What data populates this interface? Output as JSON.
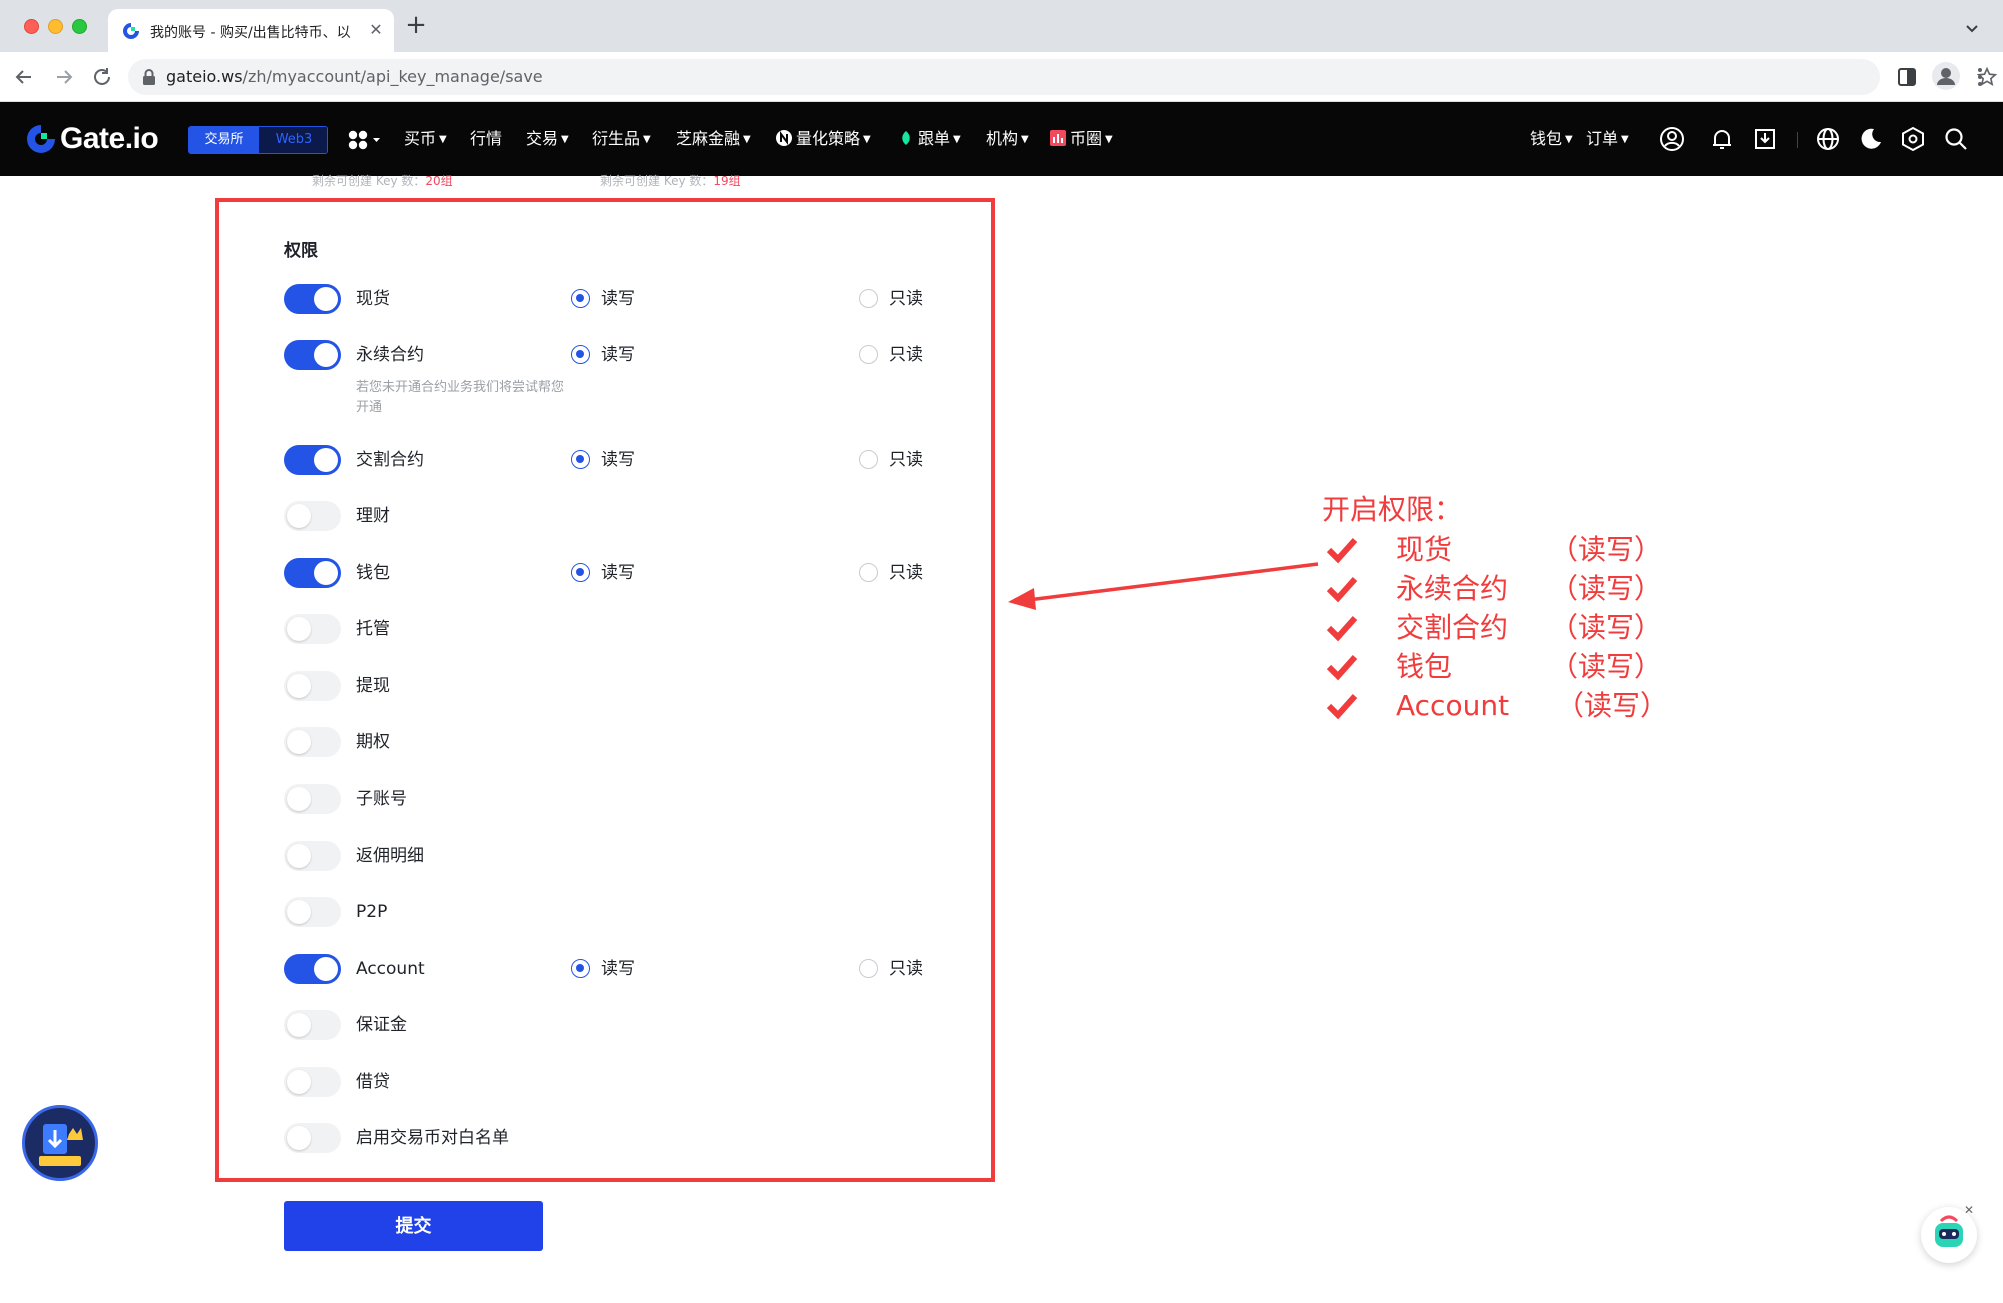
{
  "browser": {
    "tab_title": "我的账号 - 购买/出售比特币、以",
    "url_host": "gateio.ws",
    "url_path": "/zh/myaccount/api_key_manage/save"
  },
  "header": {
    "logo_text": "Gate.io",
    "mode_exchange": "交易所",
    "mode_web3": "Web3",
    "nav": [
      {
        "label": "买币"
      },
      {
        "label": "行情"
      },
      {
        "label": "交易"
      },
      {
        "label": "衍生品"
      },
      {
        "label": "芝麻金融"
      },
      {
        "label": "量化策略"
      },
      {
        "label": "跟单"
      },
      {
        "label": "机构"
      },
      {
        "label": "币圈"
      }
    ],
    "right_nav": [
      {
        "label": "钱包"
      },
      {
        "label": "订单"
      }
    ],
    "brand_color": "#2354e6"
  },
  "faded": {
    "left_text": "剩余可创建 Key 数：",
    "left_count": "20组",
    "right_text": "剩余可创建 Key 数：",
    "right_count": "19组"
  },
  "permissions": {
    "title": "权限",
    "read_write_label": "读写",
    "read_only_label": "只读",
    "items": [
      {
        "label": "现货",
        "enabled": true,
        "mode": "读写"
      },
      {
        "label": "永续合约",
        "enabled": true,
        "mode": "读写",
        "note": "若您未开通合约业务我们将尝试帮您开通"
      },
      {
        "label": "交割合约",
        "enabled": true,
        "mode": "读写"
      },
      {
        "label": "理财",
        "enabled": false
      },
      {
        "label": "钱包",
        "enabled": true,
        "mode": "读写"
      },
      {
        "label": "托管",
        "enabled": false
      },
      {
        "label": "提现",
        "enabled": false
      },
      {
        "label": "期权",
        "enabled": false
      },
      {
        "label": "子账号",
        "enabled": false
      },
      {
        "label": "返佣明细",
        "enabled": false
      },
      {
        "label": "P2P",
        "enabled": false
      },
      {
        "label": "Account",
        "enabled": true,
        "mode": "读写"
      },
      {
        "label": "保证金",
        "enabled": false
      },
      {
        "label": "借贷",
        "enabled": false
      },
      {
        "label": "启用交易币对白名单",
        "enabled": false
      }
    ]
  },
  "submit_label": "提交",
  "annotation": {
    "title": "开启权限：",
    "color": "#f03c3c",
    "items": [
      {
        "name": "现货",
        "mode": "（读写）"
      },
      {
        "name": "永续合约",
        "mode": "（读写）"
      },
      {
        "name": "交割合约",
        "mode": "（读写）"
      },
      {
        "name": "钱包",
        "mode": "（读写）"
      },
      {
        "name": "Account",
        "mode": "（读写）"
      }
    ]
  },
  "icons": {
    "tab_favicon": "gate-logo-icon",
    "lock": "lock-icon",
    "checkmark": "checkmark-icon"
  }
}
